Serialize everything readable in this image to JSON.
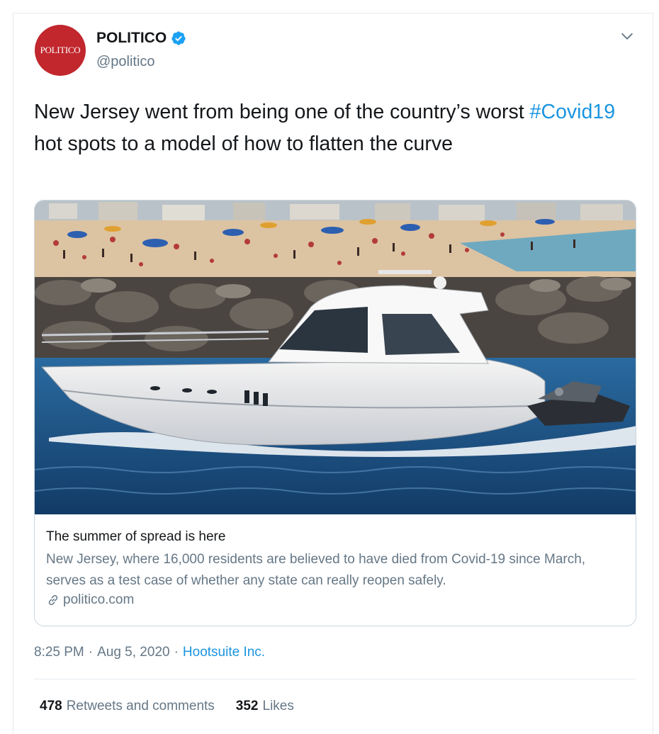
{
  "author": {
    "avatar_text": "POLITICO",
    "name": "POLITICO",
    "handle": "@politico",
    "verified": true
  },
  "tweet": {
    "text_before": "New Jersey went from being one of the country’s worst ",
    "hashtag": "#Covid19",
    "text_after": " hot spots to a model of how to flatten the curve"
  },
  "card": {
    "image_alt": "beach-boat-photo",
    "title": "The summer of spread is here",
    "description": "New Jersey, where 16,000 residents are believed to have died from Covid-19 since March, serves as a test case of whether any state can really reopen safely.",
    "domain": "politico.com"
  },
  "meta": {
    "time": "8:25 PM",
    "separator1": "·",
    "date": "Aug 5, 2020",
    "separator2": "·",
    "source": "Hootsuite Inc."
  },
  "stats": {
    "retweets_count": "478",
    "retweets_label": "Retweets and comments",
    "likes_count": "352",
    "likes_label": "Likes"
  },
  "colors": {
    "brand_red": "#c1272d",
    "link_blue": "#1b95e0",
    "muted": "#657786",
    "text": "#14171a"
  },
  "icons": [
    "verified-icon",
    "chevron-down-icon",
    "link-icon"
  ]
}
